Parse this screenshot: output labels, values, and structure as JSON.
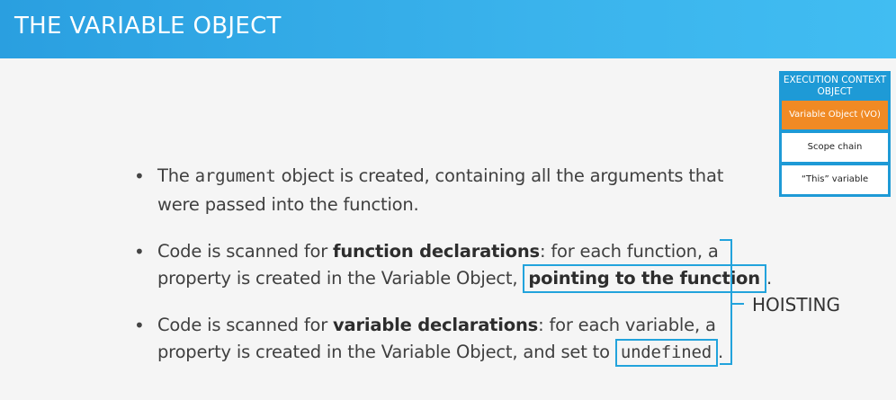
{
  "header": {
    "title": "THE VARIABLE OBJECT"
  },
  "execution_context": {
    "heading_line1": "EXECUTION CONTEXT",
    "heading_line2": "OBJECT",
    "items": [
      {
        "label": "Variable Object (VO)"
      },
      {
        "label": "Scope chain"
      },
      {
        "label": "“This” variable"
      }
    ]
  },
  "bullets": [
    {
      "line1_pre": "The ",
      "line1_code": "argument",
      "line1_post": " object is created, containing all the arguments that",
      "line2": "were passed into the function."
    },
    {
      "line1_pre": "Code is scanned for ",
      "line1_bold": "function declarations",
      "line1_post": ": for each function, a",
      "line2_pre": "property is created in the Variable Object, ",
      "line2_highlight": "pointing to the function",
      "line2_post": "."
    },
    {
      "line1_pre": "Code is scanned for ",
      "line1_bold": "variable declarations",
      "line1_post": ": for each variable, a",
      "line2_pre": "property is created in the Variable Object, and set to ",
      "line2_highlight": "undefined",
      "line2_post": "."
    }
  ],
  "hoisting_label": "HOISTING",
  "colors": {
    "header_blue": "#2a9fe0",
    "accent_blue": "#22a3dc",
    "vo_orange": "#f08a24"
  }
}
